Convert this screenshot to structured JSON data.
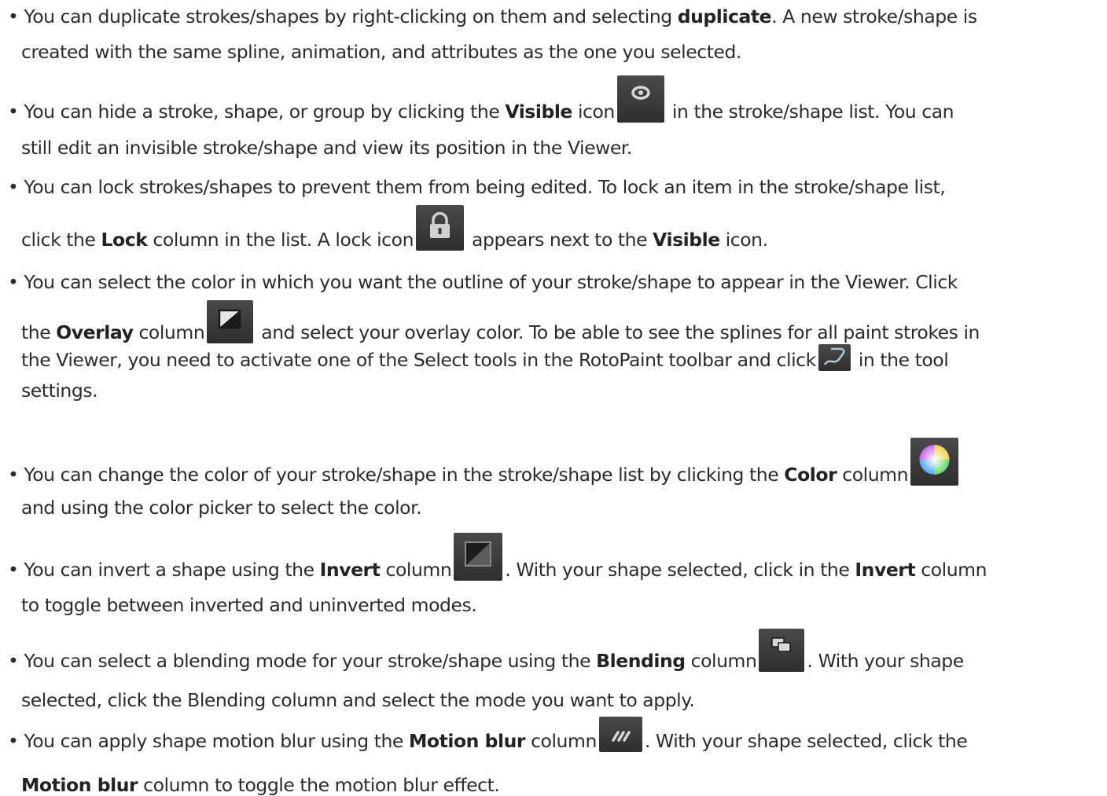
{
  "bullets": [
    {
      "l1": [
        "• You can duplicate strokes/shapes by right-clicking on them and selecting ",
        "duplicate",
        ". A new stroke/shape is"
      ],
      "l2": "created with the same spline, animation, and attributes as the one you selected."
    },
    {
      "l1": [
        "• You can hide a stroke, shape, or group by clicking the ",
        "Visible",
        " icon",
        " in the stroke/shape list. You can"
      ],
      "l2": "still edit an invisible stroke/shape and view its position in the Viewer.",
      "icon": "eye-icon"
    },
    {
      "l1": "• You can lock strokes/shapes to prevent them from being edited. To lock an item in the stroke/shape list,",
      "l2": [
        "click the ",
        "Lock",
        " column in the list. A lock icon",
        " appears next to the ",
        "Visible",
        " icon."
      ],
      "icon": "lock-icon"
    },
    {
      "l1": "• You can select the color in which you want the outline of your stroke/shape to appear in the Viewer. Click",
      "l2": [
        "the ",
        "Overlay",
        " column",
        " and select your overlay color. To be able to see the splines for all paint strokes in"
      ],
      "l3": [
        "the Viewer, you need to activate one of the Select tools in the RotoPaint toolbar and click",
        " in the tool"
      ],
      "l4": "settings.",
      "icons": [
        "overlay-icon",
        "spline-icon"
      ]
    },
    {
      "l1": [
        "• You can change the color of your stroke/shape in the stroke/shape list by clicking the ",
        "Color",
        " column"
      ],
      "l2": "and using the color picker to select the color.",
      "icon": "color-wheel-icon"
    },
    {
      "l1": [
        "• You can invert a shape using the ",
        "Invert",
        " column",
        ". With your shape selected, click in the ",
        "Invert",
        " column"
      ],
      "l2": "to toggle between inverted and uninverted modes.",
      "icon": "invert-icon"
    },
    {
      "l1": [
        "• You can select a blending mode for your stroke/shape using the ",
        "Blending",
        " column",
        ". With your shape"
      ],
      "l2": "selected, click the Blending column and select the mode you want to apply.",
      "icon": "blending-icon"
    },
    {
      "l1": [
        "• You can apply shape motion blur using the ",
        "Motion blur",
        " column",
        ". With your shape selected, click the"
      ],
      "l2": [
        "Motion blur",
        " column to toggle the motion blur effect."
      ],
      "icon": "motion-blur-icon"
    }
  ]
}
